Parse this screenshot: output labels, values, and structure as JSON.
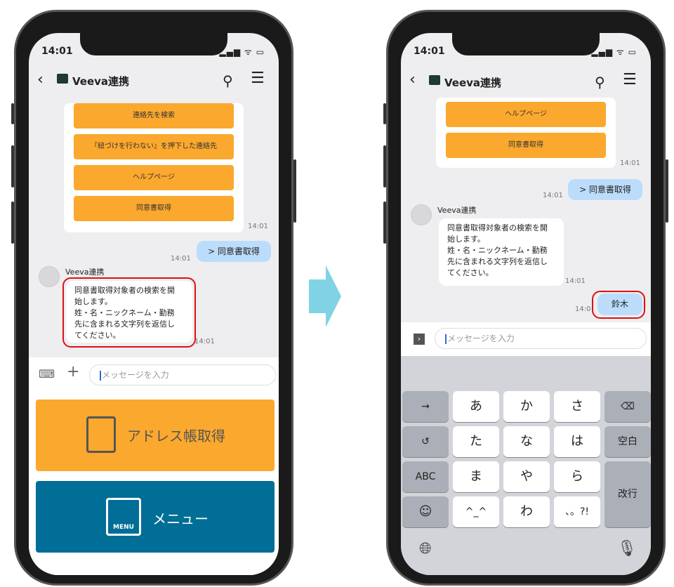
{
  "status_time": "14:01",
  "header": {
    "title": "Veeva連携",
    "back_icon": "chevron-left-icon",
    "bot_icon": "robot-icon",
    "search_icon": "search-icon",
    "menu_icon": "hamburger-icon"
  },
  "left": {
    "menu_buttons": [
      "連絡先を検索",
      "『紐づけを行わない』を押下した連絡先",
      "ヘルプページ",
      "同意書取得"
    ],
    "card_time": "14:01",
    "user_msg": "> 同意書取得",
    "user_time": "14:01",
    "bot_name": "Veeva連携",
    "bot_msg_lines": [
      "同意書取得対象者の検索を開",
      "始します。",
      "姓・名・ニックネーム・勤務",
      "先に含まれる文字列を返信し",
      "てください。"
    ],
    "bot_time": "14:01",
    "input_placeholder": "メッセージを入力",
    "rich_menu": [
      {
        "label": "アドレス帳取得",
        "icon": "address-book-icon",
        "color": "#fba82e"
      },
      {
        "label": "メニュー",
        "icon_text": "MENU",
        "icon": "menu-icon",
        "color": "#006e96"
      }
    ]
  },
  "right": {
    "menu_buttons": [
      "ヘルプページ",
      "同意書取得"
    ],
    "card_time": "14:01",
    "user_msg": "> 同意書取得",
    "user_time": "14:01",
    "bot_name": "Veeva連携",
    "bot_msg_lines": [
      "同意書取得対象者の検索を開",
      "始します。",
      "姓・名・ニックネーム・勤務",
      "先に含まれる文字列を返信し",
      "てください。"
    ],
    "bot_time": "14:01",
    "reply_msg": "鈴木",
    "reply_time": "14:0",
    "input_placeholder": "メッセージを入力",
    "keyboard": {
      "rows": [
        [
          "→",
          "あ",
          "か",
          "さ",
          "⌫"
        ],
        [
          "↺",
          "た",
          "な",
          "は",
          "空白"
        ],
        [
          "ABC",
          "ま",
          "や",
          "ら",
          "改行"
        ],
        [
          "☺",
          "^_^",
          "わ",
          "、。?!"
        ]
      ],
      "globe_icon": "globe-icon",
      "mic_icon": "microphone-icon"
    }
  },
  "arrow_color": "#7fd3e4",
  "highlight_color": "#e01010"
}
